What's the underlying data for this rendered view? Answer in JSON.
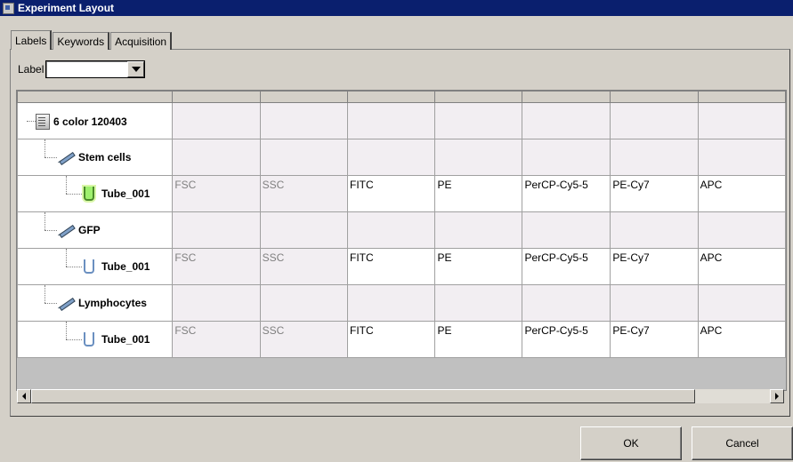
{
  "window": {
    "title": "Experiment Layout"
  },
  "tabs": [
    {
      "label": "Labels",
      "active": true
    },
    {
      "label": "Keywords",
      "active": false
    },
    {
      "label": "Acquisition",
      "active": false
    }
  ],
  "label_selector": {
    "label": "Label",
    "value": ""
  },
  "tree": {
    "experiment": {
      "label": "6 color 120403",
      "icon": "experiment-icon"
    },
    "specimens": [
      {
        "label": "Stem cells",
        "icon": "specimen-icon",
        "tube": {
          "label": "Tube_001",
          "icon": "tube-active-icon",
          "active": true
        }
      },
      {
        "label": "GFP",
        "icon": "specimen-icon",
        "tube": {
          "label": "Tube_001",
          "icon": "tube-icon",
          "active": false
        }
      },
      {
        "label": "Lymphocytes",
        "icon": "specimen-icon",
        "tube": {
          "label": "Tube_001",
          "icon": "tube-icon",
          "active": false
        }
      }
    ]
  },
  "parameters": [
    "FSC",
    "SSC",
    "FITC",
    "PE",
    "PerCP-Cy5-5",
    "PE-Cy7",
    "APC"
  ],
  "buttons": {
    "ok": "OK",
    "cancel": "Cancel"
  }
}
